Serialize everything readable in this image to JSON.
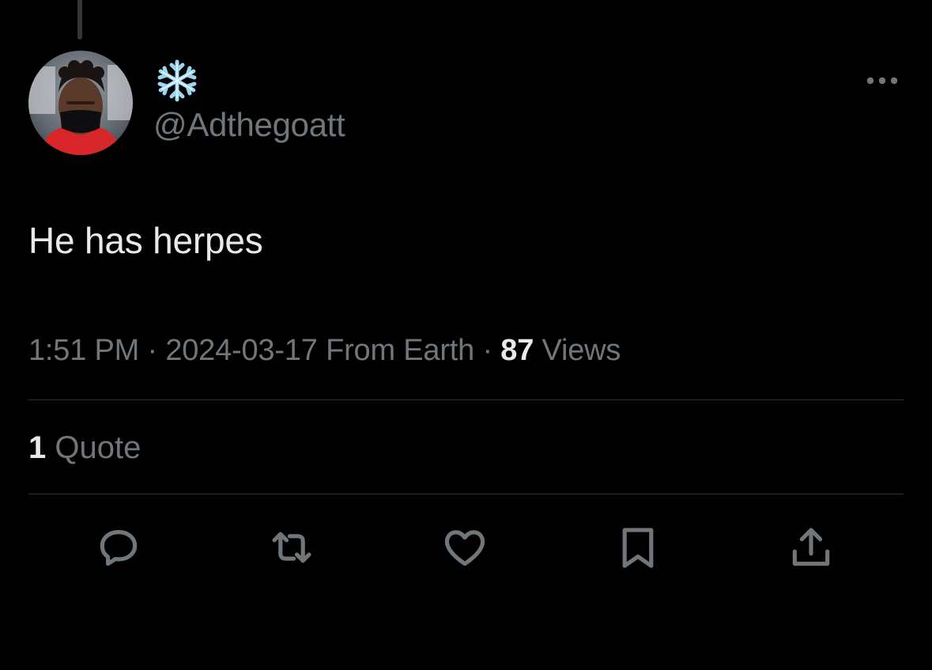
{
  "tweet": {
    "display_name_icon": "snowflake-emoji",
    "handle": "@Adthegoatt",
    "text": "He has herpes",
    "time": "1:51 PM",
    "separator": "·",
    "date": "2024-03-17",
    "source": "From Earth",
    "views_count": "87",
    "views_label": "Views",
    "quote_count": "1",
    "quote_label": "Quote"
  },
  "actions": [
    {
      "name": "reply",
      "icon": "reply-icon"
    },
    {
      "name": "retweet",
      "icon": "retweet-icon"
    },
    {
      "name": "like",
      "icon": "heart-icon"
    },
    {
      "name": "bookmark",
      "icon": "bookmark-icon"
    },
    {
      "name": "share",
      "icon": "share-icon"
    }
  ],
  "colors": {
    "background": "#000000",
    "primary_text": "#e7e9ea",
    "secondary_text": "#71767b",
    "divider": "#2f3336",
    "snowflake": "#9fd4f0"
  }
}
